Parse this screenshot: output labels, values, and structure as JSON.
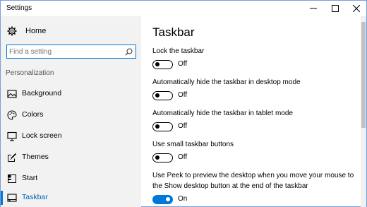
{
  "window": {
    "title": "Settings"
  },
  "sidebar": {
    "home_label": "Home",
    "search": {
      "placeholder": "Find a setting",
      "value": ""
    },
    "section_label": "Personalization",
    "items": [
      {
        "label": "Background",
        "icon": "picture-icon",
        "active": false
      },
      {
        "label": "Colors",
        "icon": "palette-icon",
        "active": false
      },
      {
        "label": "Lock screen",
        "icon": "monitor-lock-icon",
        "active": false
      },
      {
        "label": "Themes",
        "icon": "brush-icon",
        "active": false
      },
      {
        "label": "Start",
        "icon": "start-grid-icon",
        "active": false
      },
      {
        "label": "Taskbar",
        "icon": "taskbar-icon",
        "active": true
      }
    ]
  },
  "main": {
    "title": "Taskbar",
    "settings": [
      {
        "label": "Lock the taskbar",
        "state": "Off",
        "on": false
      },
      {
        "label": "Automatically hide the taskbar in desktop mode",
        "state": "Off",
        "on": false
      },
      {
        "label": "Automatically hide the taskbar in tablet mode",
        "state": "Off",
        "on": false
      },
      {
        "label": "Use small taskbar buttons",
        "state": "Off",
        "on": false
      },
      {
        "label": "Use Peek to preview the desktop when you move your mouse to the Show desktop button at the end of the taskbar",
        "state": "On",
        "on": true
      }
    ]
  },
  "colors": {
    "accent": "#0078d7",
    "active_text": "#0063b1",
    "sidebar_bg": "#f2f2f2"
  }
}
